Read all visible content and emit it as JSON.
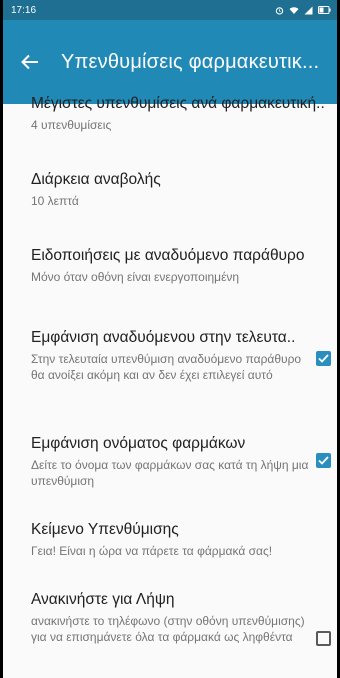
{
  "status": {
    "time": "17:16"
  },
  "appbar": {
    "title": "Υπενθυμίσεις φαρμακευτικ..."
  },
  "settings": [
    {
      "title": "Μέγιστες υπενθυμίσεις ανά φαρμακευτική..",
      "subtitle": "4 υπενθυμίσεις"
    },
    {
      "title": "Διάρκεια αναβολής",
      "subtitle": "10 λεπτά"
    },
    {
      "title": "Ειδοποιήσεις με αναδυόμενο παράθυρο",
      "subtitle": "Μόνο όταν οθόνη είναι ενεργοποιημένη"
    },
    {
      "title": "Εμφάνιση αναδυόμενου στην τελευτα..",
      "subtitle": "Στην τελευταία υπενθύμιση αναδυόμενο παράθυρο θα ανοίξει ακόμη και αν δεν έχει επιλεγεί αυτό",
      "checked": true
    },
    {
      "title": "Εμφάνιση ονόματος φαρμάκων",
      "subtitle": "Δείτε το όνομα των φαρμάκων σας κατά τη λήψη μια υπενθύμιση",
      "checked": true
    },
    {
      "title": "Κείμενο Υπενθύμισης",
      "subtitle": "Γεια! Είναι η ώρα να πάρετε τα φάρμακά σας!"
    },
    {
      "title": "Ανακινήστε για Λήψη",
      "subtitle": "ανακινήστε το τηλέφωνο (στην οθόνη υπενθύμισης) για να επισημάνετε όλα τα φάρμακά ως ληφθέντα",
      "checked": false
    }
  ],
  "colors": {
    "appbar": "#2189b6",
    "statusbar": "#1e6f91",
    "checkbox": "#2a8fbf"
  }
}
